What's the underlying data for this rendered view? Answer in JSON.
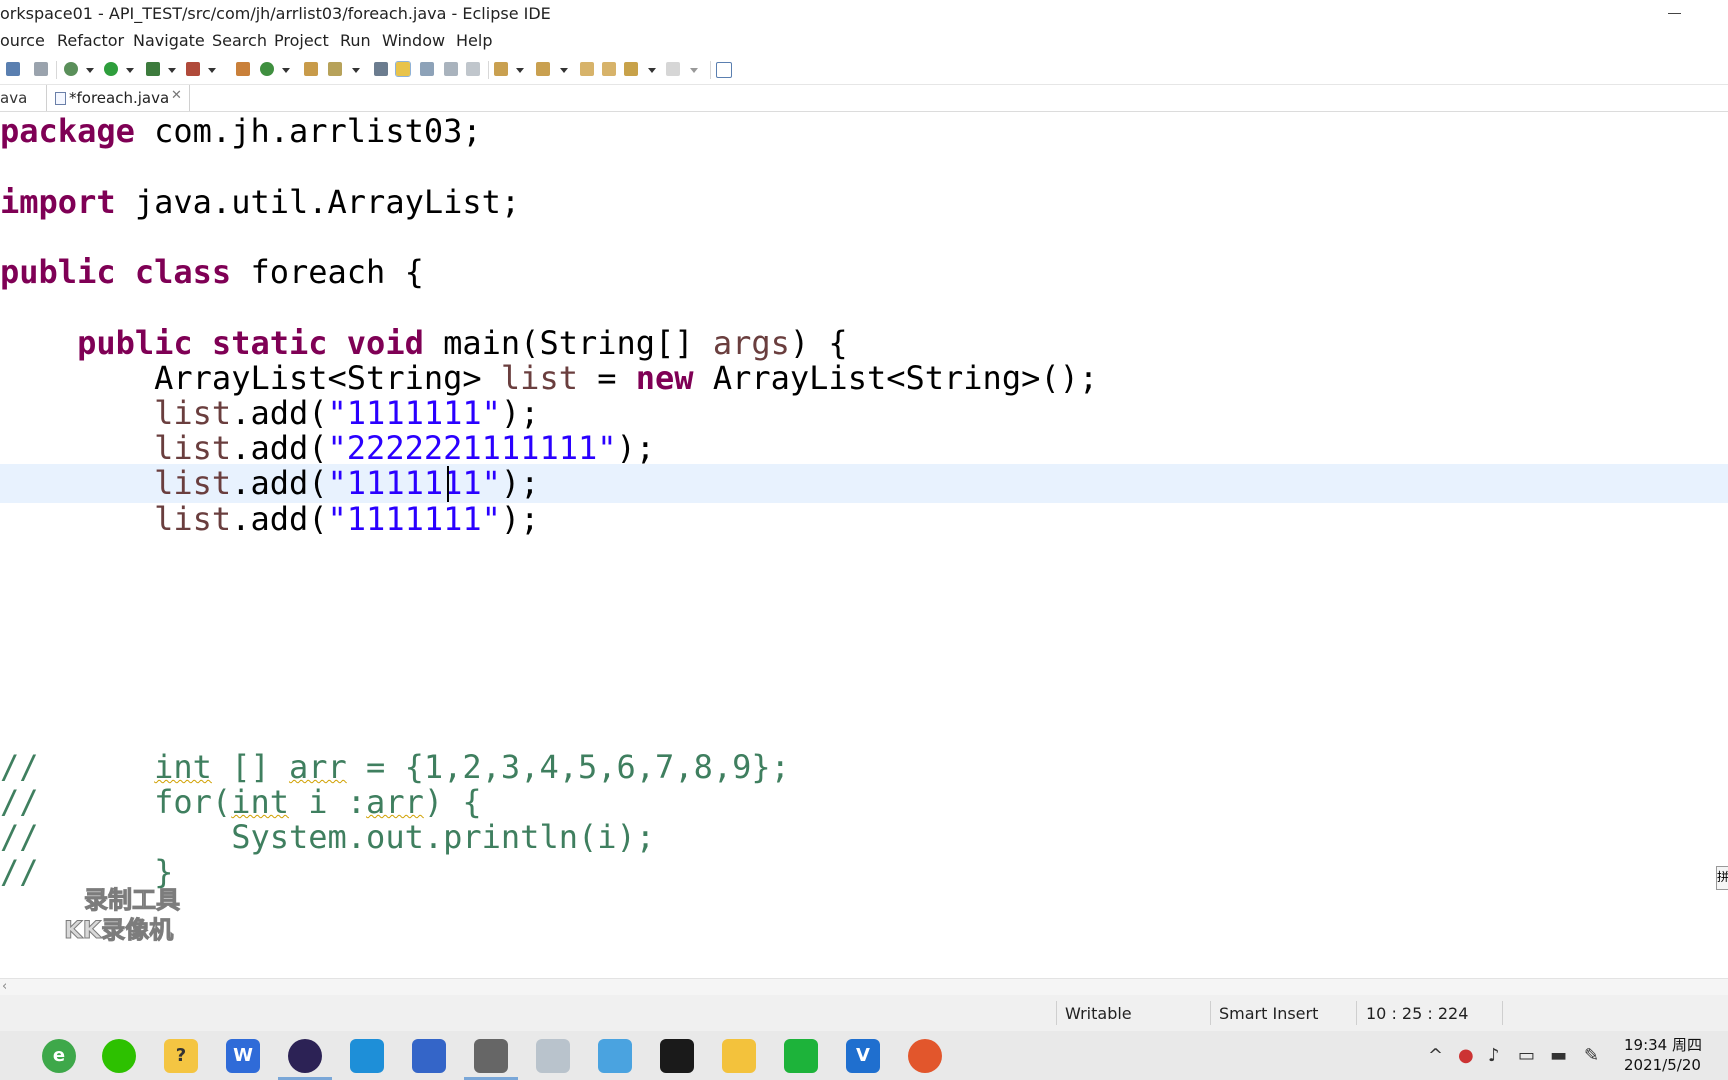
{
  "window": {
    "title": "orkspace01 - API_TEST/src/com/jh/arrlist03/foreach.java - Eclipse IDE"
  },
  "menu": [
    "ource",
    "Refactor",
    "Navigate",
    "Search",
    "Project",
    "Run",
    "Window",
    "Help"
  ],
  "tabs": {
    "previous": "ava",
    "active": "*foreach.java",
    "close_glyph": "✕"
  },
  "editor": {
    "lines": {
      "l1": {
        "kw": "package",
        "rest": " com.jh.arrlist03;"
      },
      "l2": {
        "kw": "import",
        "rest": " java.util.ArrayList;"
      },
      "l3": {
        "kw1": "public",
        "kw2": "class",
        "rest": " foreach {"
      },
      "l4": {
        "indent": "    ",
        "kw1": "public",
        "kw2": "static",
        "kw3": "void",
        "mid": " main(String[] ",
        "var": "args",
        "end": ") {"
      },
      "l5": {
        "indent": "        ",
        "pre": "ArrayList<String> ",
        "var": "list",
        "mid": " = ",
        "kw": "new",
        "end": " ArrayList<String>();"
      },
      "l6": {
        "indent": "        ",
        "var": "list",
        "mid": ".add(",
        "str": "\"1111111\"",
        "end": ");"
      },
      "l7": {
        "indent": "        ",
        "var": "list",
        "mid": ".add(",
        "str": "\"2222221111111\"",
        "end": ");"
      },
      "l8": {
        "indent": "        ",
        "var": "list",
        "mid": ".add(",
        "str": "\"1111111\"",
        "end": ");"
      },
      "l9": {
        "indent": "        ",
        "var": "list",
        "mid": ".add(",
        "str": "\"1111111\"",
        "end": ");"
      },
      "c1": {
        "pre": "//      ",
        "a": "int",
        "b": " [] ",
        "c": "arr",
        "d": " = {1,2,3,4,5,6,7,8,9};"
      },
      "c2": {
        "pre": "//      for(",
        "a": "int",
        "b": " i :",
        "c": "arr",
        "d": ") {"
      },
      "c3": {
        "text": "//          System.out.println(i);"
      },
      "c4": {
        "text": "//      }"
      }
    }
  },
  "watermark": {
    "line1": "录制工具",
    "line2": "KK录像机"
  },
  "overview_marker": "拼",
  "status": {
    "writable": "Writable",
    "insert_mode": "Smart Insert",
    "position": "10 : 25 : 224"
  },
  "taskbar": {
    "apps": [
      "browser-icon",
      "wechat-icon",
      "notes-icon",
      "wps-icon",
      "eclipse-icon",
      "contacts-icon",
      "app-icon",
      "gear-app-icon",
      "files-icon",
      "screen-icon",
      "terminal-icon",
      "folder-icon",
      "video-icon",
      "vc-icon",
      "game-icon"
    ],
    "time": "19:34 周四",
    "date": "2021/5/20"
  },
  "colors": {
    "keyword": "#7f0055",
    "string": "#2a00ff",
    "variable": "#6a3e3e",
    "comment": "#3f7f5f",
    "current_line": "#e8f2fe"
  }
}
